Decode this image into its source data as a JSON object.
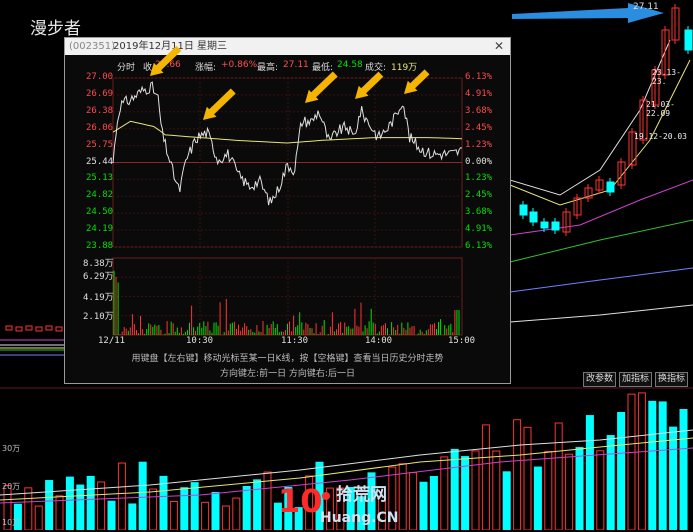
{
  "stock": {
    "name": "漫步者"
  },
  "top_price": "27.11",
  "background_labels": [
    "23.13-23.",
    "21.03-22.09",
    "19.12-20.03"
  ],
  "toolbar": {
    "buttons": [
      "改参数",
      "加指标",
      "换指标"
    ]
  },
  "volume_axis": [
    "30万",
    "20万",
    "10万"
  ],
  "popup": {
    "code": "(002351)",
    "date": "2019年12月11日",
    "weekday": "星期三",
    "close_glyph": "✕",
    "info": {
      "mode": "分时",
      "last_label": "收",
      "last_value": "25.66",
      "change_label": "涨幅:",
      "change_value": "+0.86%",
      "high_label": "最高:",
      "high_value": "27.11",
      "low_label": "最低:",
      "low_value": "24.58",
      "volume_label": "成交:",
      "volume_value": "119万"
    },
    "price_axis": [
      "27.00",
      "26.69",
      "26.38",
      "26.06",
      "25.75",
      "25.44",
      "25.13",
      "24.82",
      "24.50",
      "24.19",
      "23.88"
    ],
    "pct_axis": [
      "6.13%",
      "4.91%",
      "3.68%",
      "2.45%",
      "1.23%",
      "0.00%",
      "1.23%",
      "2.45%",
      "3.68%",
      "4.91%",
      "6.13%"
    ],
    "volume_axis": [
      "8.38万",
      "6.29万",
      "4.19万",
      "2.10万"
    ],
    "time_axis": [
      "12/11",
      "10:30",
      "11:30",
      "14:00",
      "15:00"
    ],
    "hint_line1": "用键盘【左右键】移动光标至某一日K线，按【空格键】查看当日历史分时走势",
    "hint_line2": "方向键左:前一日   方向键右:后一日"
  },
  "colors": {
    "up": "#ff3232",
    "down": "#00ffff",
    "flat": "#e0e0e0",
    "avg": "#e6e676",
    "arrow_yellow": "#f5b400",
    "arrow_blue": "#2a8de0"
  },
  "watermark": {
    "number": "10",
    "brand_cn": "拾荒网",
    "brand_en": "Huang.CN"
  }
}
